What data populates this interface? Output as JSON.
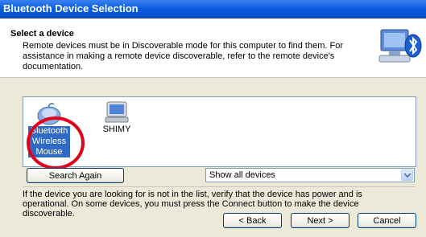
{
  "window": {
    "title": "Bluetooth Device Selection"
  },
  "header": {
    "title": "Select a device",
    "description": "Remote devices must be in Discoverable mode for this computer to find them. For assistance in making a remote device discoverable, refer to the remote device's documentation."
  },
  "devices": [
    {
      "label": "Bluetooth Wireless Mouse",
      "icon": "mouse-icon",
      "selected": true
    },
    {
      "label": "SHIMY",
      "icon": "computer-icon",
      "selected": false
    }
  ],
  "search_again_label": "Search Again",
  "filter": {
    "value": "Show all devices"
  },
  "info_text": "If the device you are looking for is not in the list, verify that the device has power and is operational. On some devices, you must press the Connect button to make the device discoverable.",
  "buttons": {
    "back": "Back",
    "next": "Next",
    "cancel": "Cancel"
  },
  "colors": {
    "title_bar": "#0a5de0",
    "selection": "#316ac5",
    "highlight_circle": "#e2001a",
    "dialog_bg": "#ece9d8"
  }
}
